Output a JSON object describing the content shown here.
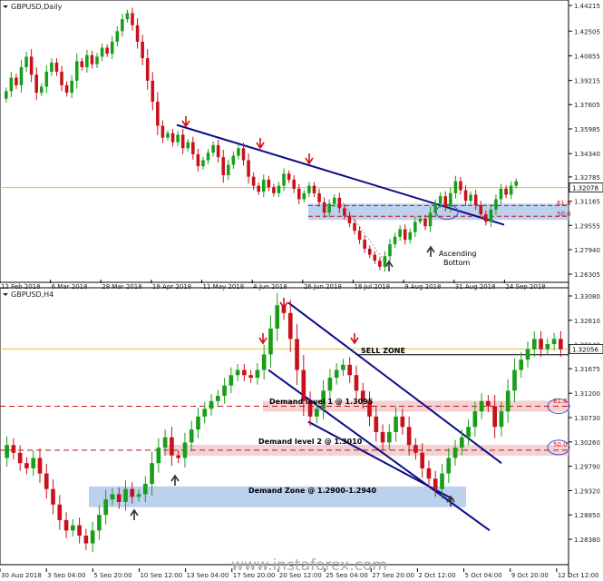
{
  "chart_data": [
    {
      "type": "candlestick",
      "title": "GBPUSD,Daily",
      "current_price": 1.32078,
      "y_ticks": [
        1.44215,
        1.42505,
        1.40855,
        1.39215,
        1.37605,
        1.35985,
        1.3434,
        1.32785,
        1.31165,
        1.29555,
        1.2794,
        1.26305
      ],
      "x_ticks": [
        "12 Feb 2018",
        "6 Mar 2018",
        "28 Mar 2018",
        "19 Apr 2018",
        "11 May 2018",
        "4 Jun 2018",
        "26 Jun 2018",
        "18 Jul 2018",
        "9 Aug 2018",
        "31 Aug 2018",
        "24 Sep 2018"
      ],
      "fib_levels": [
        {
          "label": "61.8",
          "price": 1.3088
        },
        {
          "label": "50.0",
          "price": 1.3016
        }
      ],
      "annotations": [
        "Ascending",
        "Bottom"
      ],
      "closes": [
        1.385,
        1.394,
        1.389,
        1.401,
        1.408,
        1.396,
        1.384,
        1.388,
        1.398,
        1.404,
        1.398,
        1.389,
        1.384,
        1.392,
        1.405,
        1.401,
        1.409,
        1.403,
        1.408,
        1.414,
        1.41,
        1.418,
        1.425,
        1.433,
        1.437,
        1.429,
        1.418,
        1.407,
        1.392,
        1.378,
        1.362,
        1.354,
        1.357,
        1.351,
        1.356,
        1.347,
        1.351,
        1.343,
        1.335,
        1.339,
        1.344,
        1.349,
        1.341,
        1.329,
        1.336,
        1.342,
        1.347,
        1.339,
        1.328,
        1.322,
        1.318,
        1.326,
        1.321,
        1.317,
        1.322,
        1.33,
        1.326,
        1.32,
        1.313,
        1.317,
        1.322,
        1.317,
        1.311,
        1.304,
        1.31,
        1.314,
        1.307,
        1.302,
        1.297,
        1.292,
        1.286,
        1.28,
        1.276,
        1.272,
        1.268,
        1.275,
        1.283,
        1.288,
        1.293,
        1.286,
        1.291,
        1.298,
        1.3,
        1.295,
        1.304,
        1.31,
        1.315,
        1.308,
        1.317,
        1.325,
        1.319,
        1.312,
        1.316,
        1.309,
        1.303,
        1.298,
        1.306,
        1.313,
        1.32,
        1.316,
        1.322,
        1.325
      ]
    },
    {
      "type": "candlestick",
      "title": "GBPUSD,H4",
      "current_price": 1.32056,
      "y_ticks": [
        1.3308,
        1.3261,
        1.3214,
        1.31675,
        1.312,
        1.3073,
        1.3026,
        1.2979,
        1.2932,
        1.2885,
        1.2838
      ],
      "x_ticks": [
        "30 Aug 2018",
        "3 Sep 04:00",
        "5 Sep 20:00",
        "10 Sep 12:00",
        "13 Sep 04:00",
        "17 Sep 20:00",
        "20 Sep 12:00",
        "25 Sep 04:00",
        "27 Sep 20:00",
        "2 Oct 12:00",
        "5 Oct 04:00",
        "9 Oct 20:00",
        "12 Oct 12:00"
      ],
      "levels": [
        {
          "label": "SELL ZONE",
          "price": 1.3205
        },
        {
          "label": "Demand level 1 @ 1.3095",
          "price": 1.3095
        },
        {
          "label": "Demand level 2 @ 1.3010",
          "price": 1.301
        }
      ],
      "fib_levels": [
        {
          "label": "61.8",
          "price": 1.3095
        },
        {
          "label": "50.0",
          "price": 1.3017
        }
      ],
      "zones": [
        {
          "label": "Demand Zone @ 1.2900-1.2940",
          "low": 1.29,
          "high": 1.294
        }
      ],
      "closes": [
        1.302,
        1.3005,
        1.2985,
        1.2975,
        1.2995,
        1.2965,
        1.2935,
        1.2905,
        1.2875,
        1.2855,
        1.2865,
        1.2845,
        1.283,
        1.2855,
        1.2885,
        1.2915,
        1.2925,
        1.291,
        1.2935,
        1.292,
        1.2925,
        1.2945,
        1.2985,
        1.3015,
        1.3035,
        1.3,
        1.2995,
        1.3025,
        1.305,
        1.3075,
        1.309,
        1.3105,
        1.3115,
        1.3135,
        1.3155,
        1.3165,
        1.3155,
        1.315,
        1.3165,
        1.3195,
        1.3245,
        1.329,
        1.3275,
        1.3225,
        1.3165,
        1.3105,
        1.3075,
        1.309,
        1.3125,
        1.315,
        1.3165,
        1.3175,
        1.3155,
        1.3125,
        1.3105,
        1.3075,
        1.3045,
        1.3025,
        1.3045,
        1.3075,
        1.3055,
        1.302,
        1.3005,
        1.2975,
        1.2955,
        1.2935,
        1.2965,
        1.2995,
        1.3015,
        1.3035,
        1.3055,
        1.3085,
        1.3105,
        1.3095,
        1.3055,
        1.3085,
        1.3125,
        1.3165,
        1.3185,
        1.3205,
        1.3225,
        1.3205,
        1.3215,
        1.3225,
        1.3205
      ]
    }
  ],
  "watermark": "www.instaforex.com",
  "colors": {
    "bull": "#1a9e1a",
    "bear": "#c8111b",
    "trendline": "#0c0c8a",
    "hline": "#c8111b",
    "price": "#e6c229",
    "zone": "#9ebde7",
    "demand": "#eec3c3"
  }
}
